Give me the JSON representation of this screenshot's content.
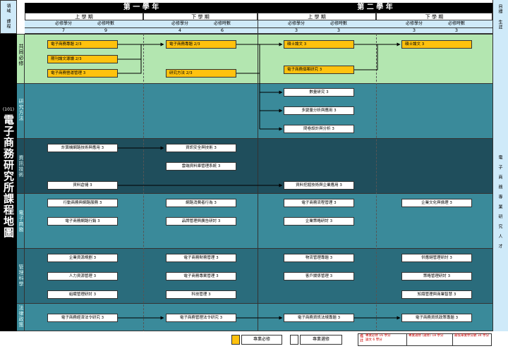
{
  "header": {
    "field_label": "領域\n課程",
    "career_label": "目標\n生涯",
    "years": [
      "第 一 學 年",
      "第 二 學 年"
    ],
    "semesters": [
      "上 學 期",
      "下 學 期",
      "上 學 期",
      "下 學 期"
    ],
    "credit_label": "必修學分",
    "hours_label": "必修時數",
    "credits": [
      "7",
      "4",
      "3",
      "3"
    ],
    "hours": [
      "9",
      "6",
      "3",
      "3"
    ]
  },
  "title": {
    "code": "(101)",
    "text": "電子商務研究所課程地圖"
  },
  "career": "電子商務專業研究人才",
  "categories": {
    "core": "共同必修",
    "research": "研究方法",
    "it": "資訊技術",
    "ecommerce": "電子商務",
    "management": "管理科學",
    "law": "法律政策"
  },
  "courses": {
    "core_1": "電子商務專題 2/3",
    "core_2": "電子商務專題 2/3",
    "core_3": "碩士論文 3",
    "core_4": "碩士論文 3",
    "core_5": "期刊論文導讀 2/3",
    "core_6": "電子商務營運管理 3",
    "core_7": "研究方法 2/3",
    "core_8": "電子商務個案研究 3",
    "res_1": "數量研究 3",
    "res_2": "多變量分析與應用 3",
    "res_3": "問卷設計與分析 3",
    "it_1": "計算機網路技術與應用 3",
    "it_2": "資訊安全與技術 3",
    "it_3": "雲端資料庫管理系統 3",
    "it_4": "資料倉儲 3",
    "it_5": "資料挖掘技術與企業應用 3",
    "ec_1": "行動商務與網路服務 3",
    "ec_2": "網路消費者行為 3",
    "ec_3": "電子商務流程管理 3",
    "ec_4": "企業文化與倫理 3",
    "ec_5": "電子商務網路行銷 3",
    "ec_6": "品牌管理與廣告研討 3",
    "ec_7": "企業策略研討 3",
    "mg_1": "企業資源規劃 3",
    "mg_2": "電子商務財務管理 3",
    "mg_3": "物流管理專題 3",
    "mg_4": "供應鏈管理研討 3",
    "mg_5": "人力資源管理 3",
    "mg_6": "電子商務專案管理 3",
    "mg_7": "客戶關係管理 3",
    "mg_8": "策略管理研討 3",
    "mg_9": "組織管理研討 3",
    "mg_10": "科技管理 3",
    "mg_11": "知識管理與商業智慧 3",
    "law_1": "電子商務經濟法令研究 3",
    "law_2": "電子商務管理法令研究 3",
    "law_3": "電子商務資訊法規專題 3",
    "law_4": "電子商務資訊政策專題 3"
  },
  "legend": {
    "core_label": "專業必修",
    "elective_label": "專業選修",
    "note_title": "備註",
    "note_1": "專業必修 16 學分\n論文 6 學分",
    "note_2": "專業選修 (選修) 18 學分",
    "note_3": "最低畢業學分數 34 學分"
  },
  "colors": {
    "core_band": "#b3e6b0",
    "research_band": "#3a8a9a",
    "it_band": "#1f4e5c",
    "ecommerce_band": "#3a8a9a",
    "management_band": "#2a6c7c",
    "law_band": "#3a8a9a",
    "core_course": "#ffc20e",
    "header_blue": "#cfeaf9"
  }
}
